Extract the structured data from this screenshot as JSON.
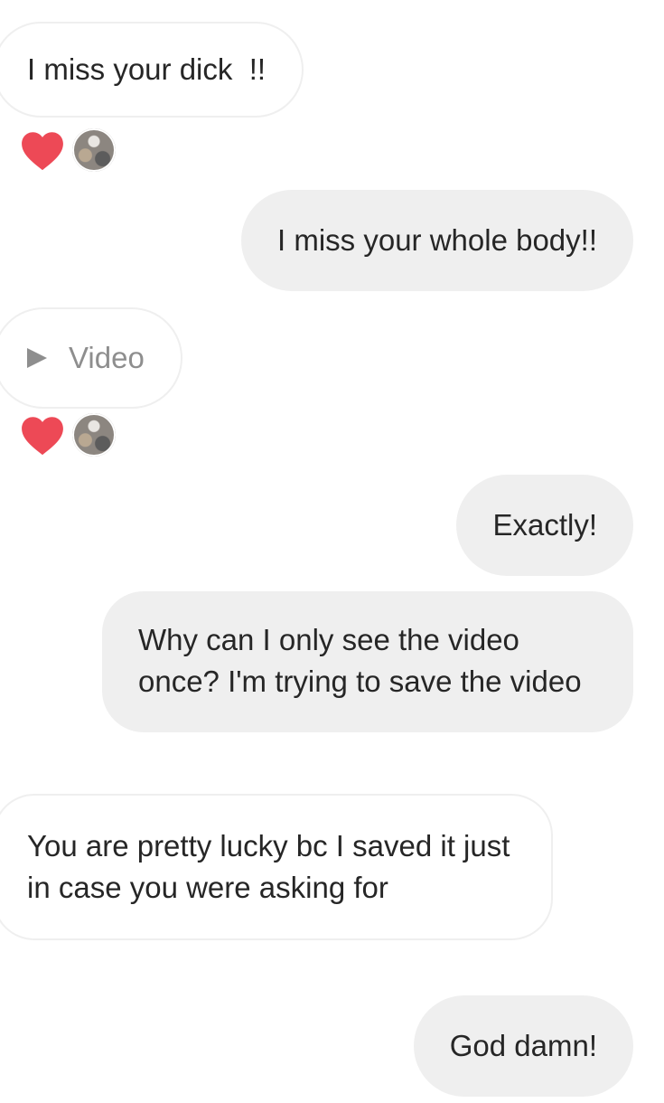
{
  "thread": {
    "messages": [
      {
        "sender": "other",
        "text": "I miss your dick  !!",
        "reactions": [
          "heart",
          "avatar"
        ]
      },
      {
        "sender": "me",
        "text": "I miss your whole body!!"
      },
      {
        "sender": "other",
        "type": "video",
        "text": "Video",
        "icon": "play-icon",
        "reactions": [
          "heart",
          "avatar"
        ]
      },
      {
        "sender": "me",
        "text": "Exactly!"
      },
      {
        "sender": "me",
        "text": "Why can I only see the video once? I'm trying to save the video"
      },
      {
        "sender": "other",
        "text": "You are pretty lucky bc I saved it just in case you were asking for"
      },
      {
        "sender": "me",
        "text": "God damn!"
      }
    ]
  },
  "colors": {
    "incoming_bubble": "#ffffff",
    "incoming_border": "#efefef",
    "outgoing_bubble": "#efefef",
    "text": "#262626",
    "muted_text": "#8e8e8e",
    "heart": "#ed4956"
  }
}
